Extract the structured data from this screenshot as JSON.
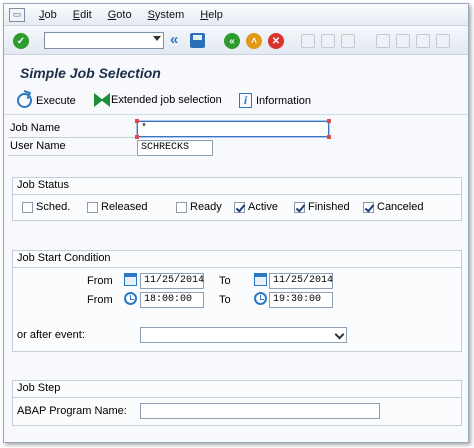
{
  "menu": {
    "items": [
      {
        "label": "Job",
        "underline": "J",
        "rest": "ob"
      },
      {
        "label": "Edit",
        "underline": "E",
        "rest": "dit"
      },
      {
        "label": "Goto",
        "underline": "G",
        "rest": "oto"
      },
      {
        "label": "System",
        "underline": "S",
        "rest": "ystem"
      },
      {
        "label": "Help",
        "underline": "H",
        "rest": "elp"
      }
    ]
  },
  "toolbar": {
    "command_value": "",
    "icons": [
      "enter-icon",
      "history-icon",
      "save-icon",
      "back-icon",
      "exit-icon",
      "cancel-icon",
      "print-icon",
      "find-icon",
      "find-next-icon",
      "first-page-icon",
      "previous-page-icon",
      "next-page-icon",
      "last-page-icon"
    ]
  },
  "title": "Simple Job Selection",
  "app_toolbar": {
    "execute": "Execute",
    "extended": "Extended job selection",
    "information": "Information"
  },
  "fields": {
    "job_name_label": "Job Name",
    "job_name_value": "*",
    "user_name_label": "User Name",
    "user_name_value": "SCHRECKS"
  },
  "job_status": {
    "title": "Job Status",
    "options": [
      {
        "label": "Sched.",
        "checked": false
      },
      {
        "label": "Released",
        "checked": false
      },
      {
        "label": "Ready",
        "checked": false
      },
      {
        "label": "Active",
        "checked": true
      },
      {
        "label": "Finished",
        "checked": true
      },
      {
        "label": "Canceled",
        "checked": true
      }
    ]
  },
  "job_start": {
    "title": "Job Start Condition",
    "from_label": "From",
    "to_label": "To",
    "from_date": "11/25/2014",
    "to_date": "11/25/2014",
    "from_time": "18:00:00",
    "to_time": "19:30:00",
    "event_label": "or after event:",
    "event_value": ""
  },
  "job_step": {
    "title": "Job Step",
    "program_label": "ABAP Program Name:",
    "program_value": ""
  },
  "colors": {
    "accent_blue": "#2b79c4",
    "ok_green": "#2e9b2e",
    "cancel_red": "#d9322a"
  }
}
